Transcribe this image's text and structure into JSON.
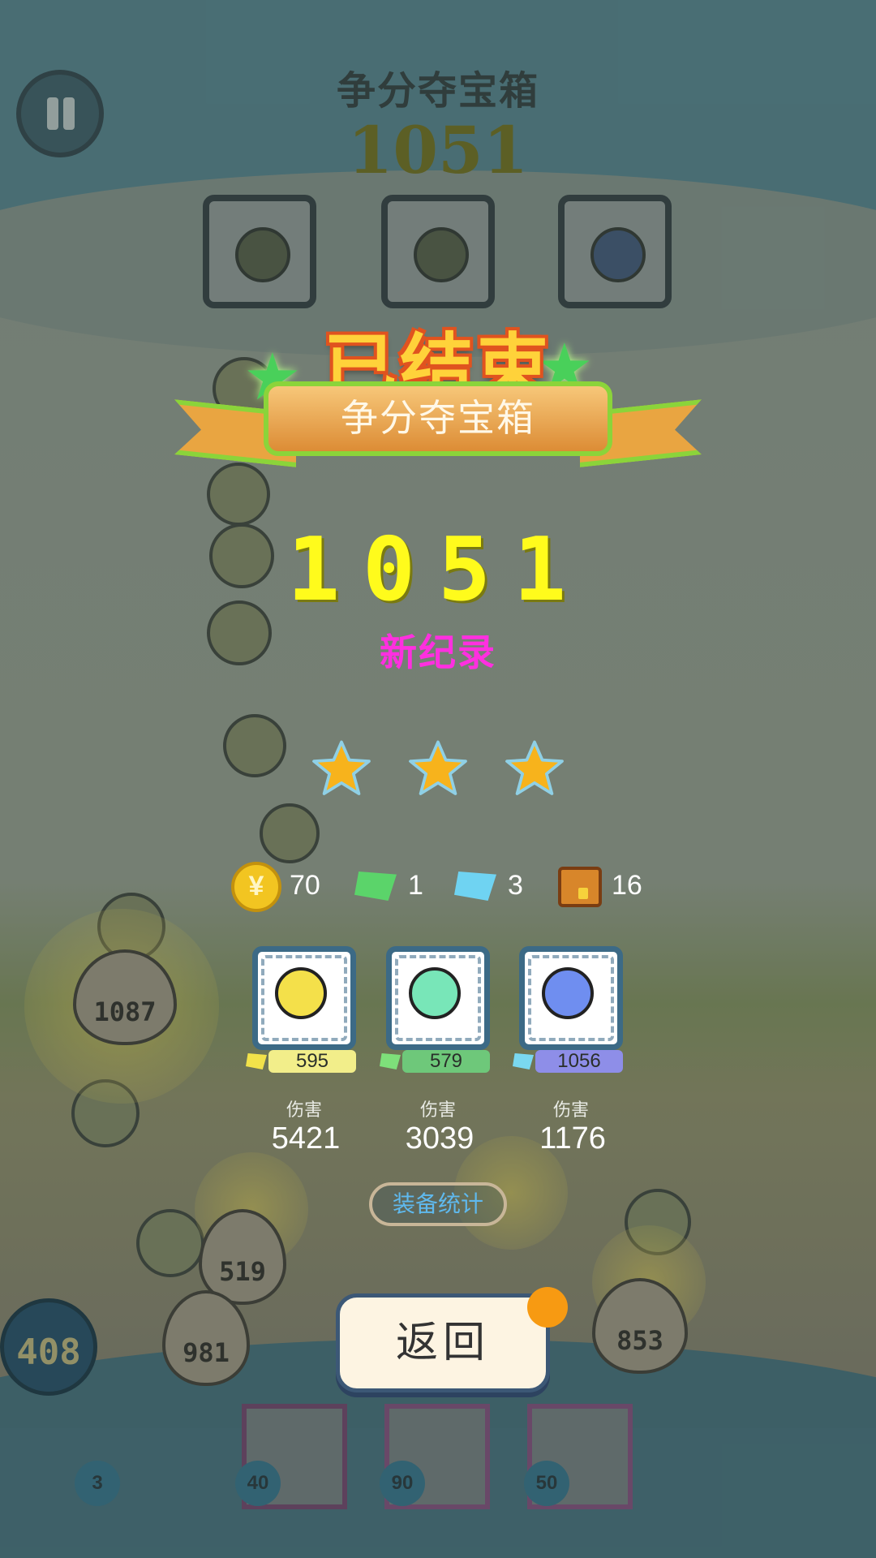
{
  "game_header": {
    "title": "争分夺宝箱",
    "score": "1051"
  },
  "result": {
    "status": "已结束",
    "mode": "争分夺宝箱",
    "score": "1051",
    "new_record": "新纪录",
    "stars_earned": 3,
    "stars_total": 3
  },
  "rewards": {
    "coins": {
      "icon": "coin-icon",
      "value": "70"
    },
    "green_gems": {
      "icon": "green-gem-icon",
      "value": "1"
    },
    "blue_gems": {
      "icon": "blue-gem-icon",
      "value": "3"
    },
    "chests": {
      "icon": "treasure-chest-icon",
      "value": "16"
    }
  },
  "heroes": [
    {
      "icon": "headphone-face-icon",
      "level": "595",
      "level_color": "#f2ee8a",
      "gem_color": "#f2e24a",
      "damage_label": "伤害",
      "damage": "5421"
    },
    {
      "icon": "bubble-face-icon",
      "level": "579",
      "level_color": "#6ec87a",
      "gem_color": "#7ee07a",
      "damage_label": "伤害",
      "damage": "3039"
    },
    {
      "icon": "taped-face-icon",
      "level": "1056",
      "level_color": "#8e8ee8",
      "gem_color": "#7ad8f0",
      "damage_label": "伤害",
      "damage": "1176"
    }
  ],
  "buttons": {
    "equipment_stats": "装备统计",
    "back": "返回"
  },
  "background": {
    "enemy_eggs": [
      "1087",
      "519",
      "981",
      "853"
    ],
    "water_drop": "408",
    "bottom_drops": [
      "3",
      "40",
      "90",
      "50"
    ]
  },
  "colors": {
    "end_title": "#ffd23a",
    "score": "#fffb1c",
    "new_record": "#ff2fe0",
    "star": "#f7b31c",
    "equip_text": "#5fb9ee",
    "notify_dot": "#f79a12"
  }
}
